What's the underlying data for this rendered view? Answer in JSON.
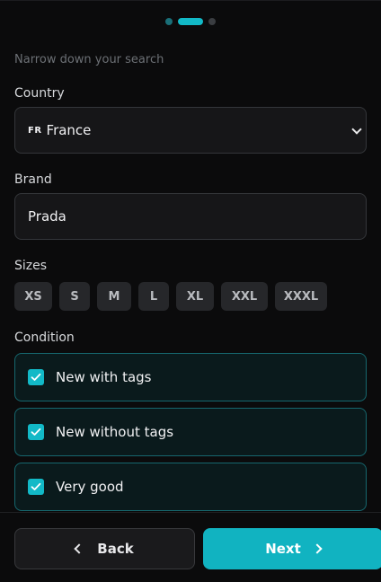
{
  "stepper": {
    "steps": 3,
    "current": 2
  },
  "subtitle": "Narrow down your search",
  "country": {
    "label": "Country",
    "flag_code": "FR",
    "value": "France"
  },
  "brand": {
    "label": "Brand",
    "value": "Prada"
  },
  "sizes": {
    "label": "Sizes",
    "options": [
      "XS",
      "S",
      "M",
      "L",
      "XL",
      "XXL",
      "XXXL"
    ]
  },
  "condition": {
    "label": "Condition",
    "options": [
      {
        "label": "New with tags",
        "checked": true
      },
      {
        "label": "New without tags",
        "checked": true
      },
      {
        "label": "Very good",
        "checked": true
      }
    ]
  },
  "footer": {
    "back_label": "Back",
    "next_label": "Next"
  },
  "colors": {
    "accent": "#12b9c7",
    "background": "#0b0b0c",
    "surface": "#161618",
    "condition_border": "#16676e"
  }
}
